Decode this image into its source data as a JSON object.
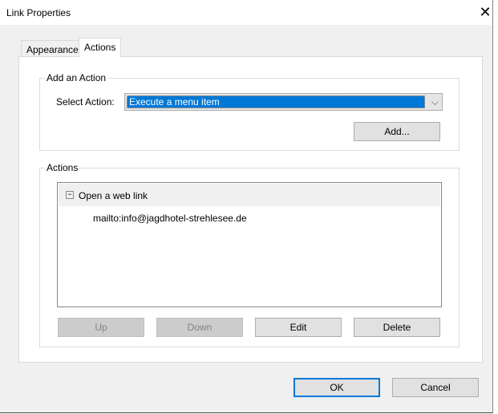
{
  "window": {
    "title": "Link Properties",
    "close_icon": "close-icon"
  },
  "tabs": [
    {
      "label": "Appearance",
      "active": false
    },
    {
      "label": "Actions",
      "active": true
    }
  ],
  "add_action": {
    "legend": "Add an Action",
    "select_label": "Select Action:",
    "select_value": "Execute a menu item",
    "add_button": "Add..."
  },
  "actions": {
    "legend": "Actions",
    "items": [
      {
        "type": "Open a web link",
        "detail": "mailto:info@jagdhotel-strehlesee.de",
        "expanded": true
      }
    ],
    "buttons": {
      "up": "Up",
      "down": "Down",
      "edit": "Edit",
      "delete": "Delete"
    }
  },
  "footer": {
    "ok": "OK",
    "cancel": "Cancel"
  }
}
